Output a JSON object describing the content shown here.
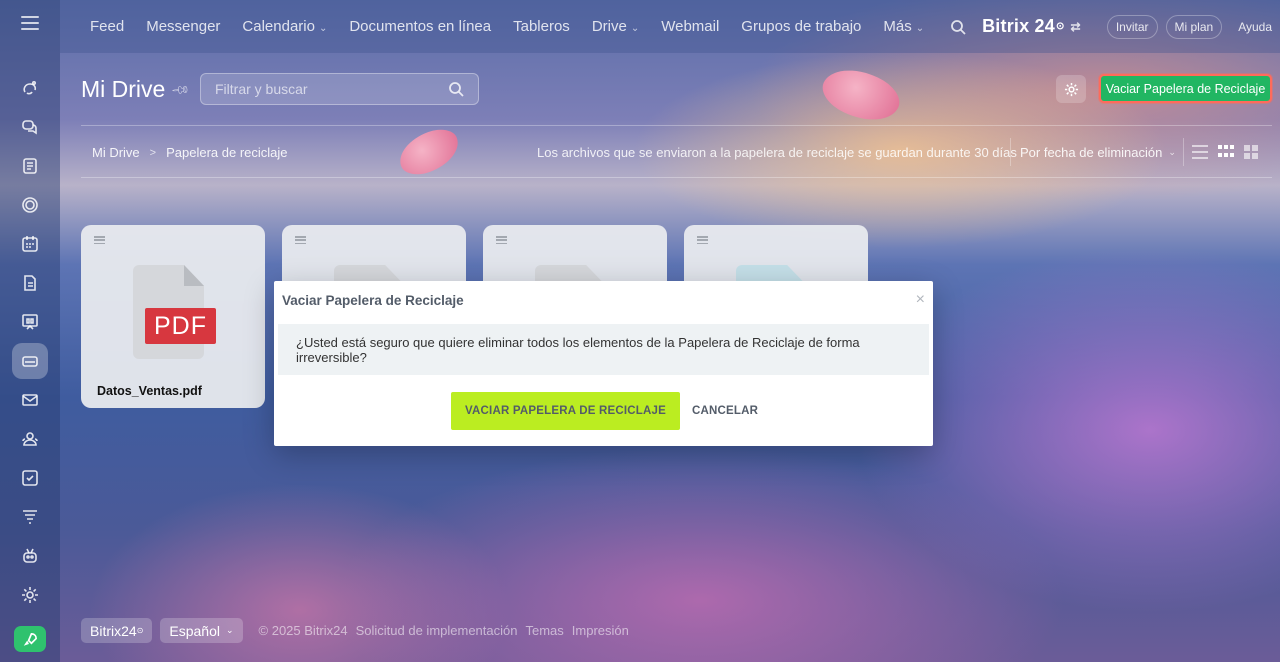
{
  "topbar": {
    "nav": [
      {
        "label": "Feed",
        "dropdown": false
      },
      {
        "label": "Messenger",
        "dropdown": false
      },
      {
        "label": "Calendario",
        "dropdown": true
      },
      {
        "label": "Documentos en línea",
        "dropdown": false
      },
      {
        "label": "Tableros",
        "dropdown": false
      },
      {
        "label": "Drive",
        "dropdown": true
      },
      {
        "label": "Webmail",
        "dropdown": false
      },
      {
        "label": "Grupos de trabajo",
        "dropdown": false
      },
      {
        "label": "Más",
        "dropdown": true
      }
    ],
    "brand": "Bitrix 24",
    "brand_mark": "⊙",
    "invite": "Invitar",
    "my_plan": "Mi plan",
    "help": "Ayuda"
  },
  "sidebar": {
    "icons": [
      "feed-icon",
      "chat-icon",
      "tasks-doc-icon",
      "crm-icon",
      "calendar-icon",
      "document-icon",
      "board-icon",
      "drive-icon",
      "mail-icon",
      "groups-icon",
      "checklist-icon",
      "filter-icon",
      "robot-icon",
      "settings-icon"
    ],
    "active": "drive-icon"
  },
  "header": {
    "title": "Mi Drive",
    "search_placeholder": "Filtrar y buscar",
    "empty_trash_label": "Vaciar Papelera de Reciclaje"
  },
  "breadcrumb": {
    "root": "Mi Drive",
    "current": "Papelera de reciclaje"
  },
  "toolbar": {
    "retention_note": "Los archivos que se enviaron a la papelera de reciclaje se guardan durante 30 días",
    "sort_label": "Por fecha de eliminación"
  },
  "files": [
    {
      "name": "Datos_Ventas.pdf",
      "type": "pdf",
      "badge": "PDF"
    }
  ],
  "modal": {
    "title": "Vaciar Papelera de Reciclaje",
    "message": "¿Usted está seguro que quiere eliminar todos los elementos de la Papelera de Reciclaje de forma irreversible?",
    "confirm_label": "VACIAR PAPELERA DE RECICLAJE",
    "cancel_label": "CANCELAR",
    "close": "×"
  },
  "footer": {
    "brand": "Bitrix24",
    "brand_mark": "⊙",
    "language": "Español",
    "copyright": "© 2025 Bitrix24",
    "links": [
      "Solicitud de implementación",
      "Temas",
      "Impresión"
    ]
  },
  "colors": {
    "accent_green": "#21b662",
    "confirm_lime": "#bbed21",
    "pdf_red": "#d7373f",
    "highlight_border": "#ff6b5b"
  }
}
